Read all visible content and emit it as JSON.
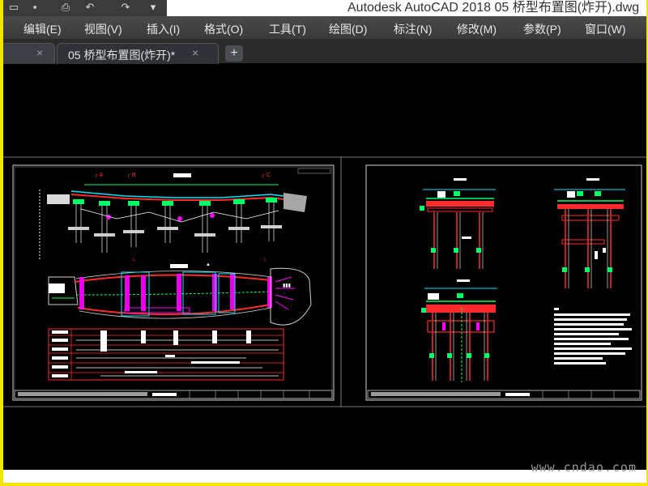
{
  "window": {
    "title": "Autodesk AutoCAD 2018    05 桥型布置图(炸开).dwg"
  },
  "quick_access": {
    "icons": [
      "open-icon",
      "save-icon",
      "print-icon",
      "undo-icon",
      "redo-icon",
      "dropdown-icon"
    ]
  },
  "menu": {
    "items": [
      "编辑(E)",
      "视图(V)",
      "插入(I)",
      "格式(O)",
      "工具(T)",
      "绘图(D)",
      "标注(N)",
      "修改(M)",
      "参数(P)",
      "窗口(W)"
    ]
  },
  "tabs": {
    "items": [
      {
        "label": "",
        "close": "×"
      },
      {
        "label": "05 桥型布置图(炸开)*",
        "close": "×"
      }
    ],
    "new_tab": "+"
  },
  "watermark": "www.cndao.com",
  "colors": {
    "background": "#000000",
    "frame": "#ffffff",
    "pier": "#00ff66",
    "beam": "#ff2a2a",
    "deck": "#ff00ff",
    "cyan": "#00e5ff",
    "outer_border": "#f2e600"
  }
}
